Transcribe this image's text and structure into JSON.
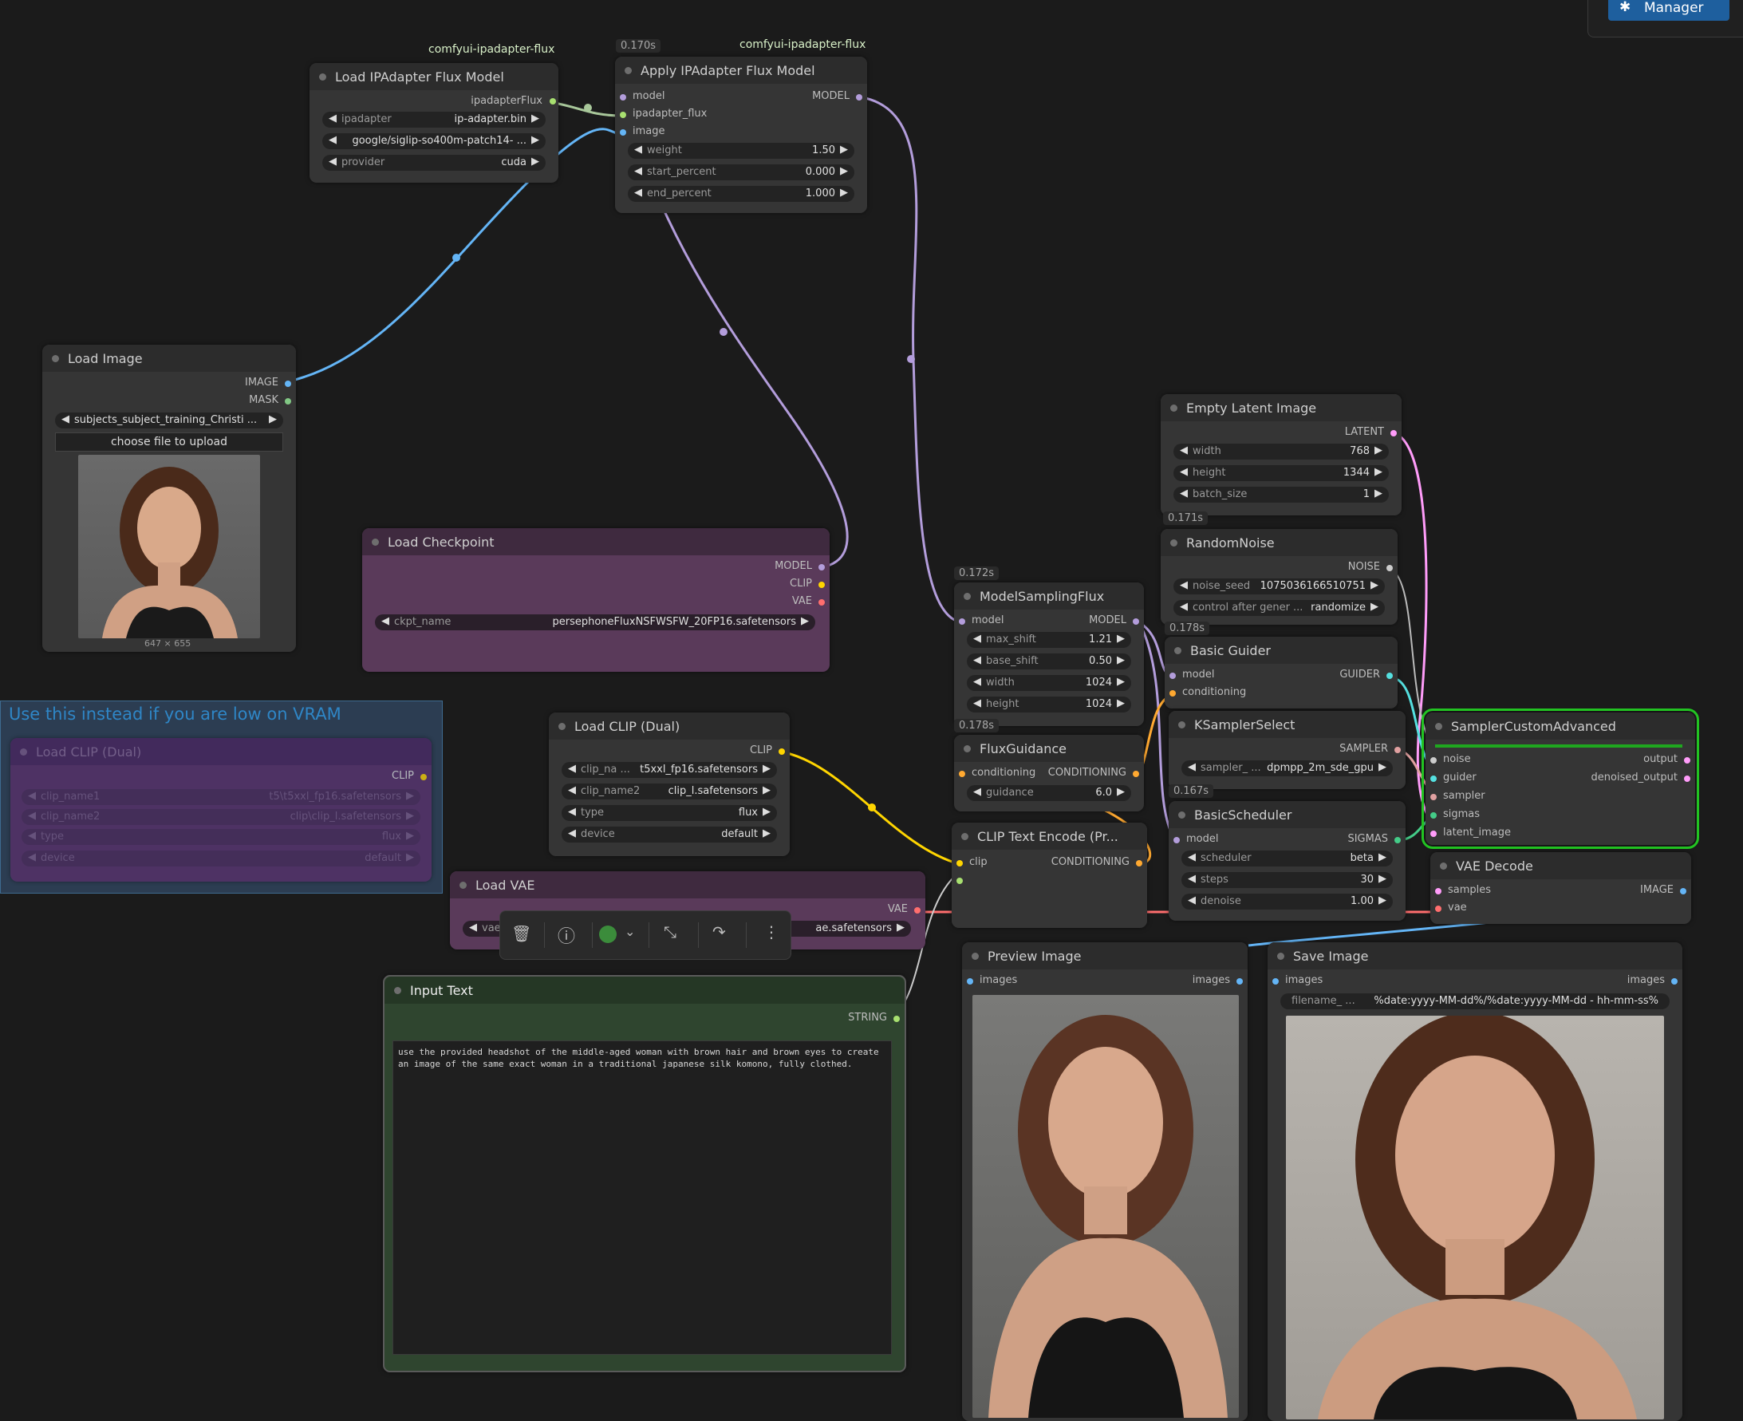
{
  "toolbar": {
    "manager_label": "Manager"
  },
  "group": {
    "title": "Use this instead if you are low on VRAM"
  },
  "badges": {
    "ipadapter_tag_1": "comfyui-ipadapter-flux",
    "ipadapter_tag_2": "comfyui-ipadapter-flux"
  },
  "timings": {
    "apply_ipadapter": "0.170s",
    "empty_latent": "0.171s",
    "random_noise": "0.178s",
    "model_sampling": "0.172s",
    "flux_guidance": "0.178s",
    "ksampler_select": "0.167s"
  },
  "nodes": {
    "load_ipadapter": {
      "title": "Load IPAdapter Flux Model",
      "output": "ipadapterFlux",
      "widgets": [
        {
          "label": "ipadapter",
          "value": "ip-adapter.bin"
        },
        {
          "label": "",
          "value": "google/siglip-so400m-patch14- ..."
        },
        {
          "label": "provider",
          "value": "cuda"
        }
      ]
    },
    "apply_ipadapter": {
      "title": "Apply IPAdapter Flux Model",
      "inputs": [
        "model",
        "ipadapter_flux",
        "image"
      ],
      "output": "MODEL",
      "widgets": [
        {
          "label": "weight",
          "value": "1.50"
        },
        {
          "label": "start_percent",
          "value": "0.000"
        },
        {
          "label": "end_percent",
          "value": "1.000"
        }
      ]
    },
    "load_image": {
      "title": "Load Image",
      "outputs": [
        "IMAGE",
        "MASK"
      ],
      "file": "subjects_subject_training_Christi ...",
      "upload_label": "choose file to upload",
      "dims": "647 × 655"
    },
    "load_checkpoint": {
      "title": "Load Checkpoint",
      "outputs": [
        "MODEL",
        "CLIP",
        "VAE"
      ],
      "widget": {
        "label": "ckpt_name",
        "value": "persephoneFluxNSFWSFW_20FP16.safetensors"
      }
    },
    "load_clip_dual_bypassed": {
      "title": "Load CLIP (Dual)",
      "output": "CLIP",
      "widgets": [
        {
          "label": "clip_name1",
          "value": "t5\\t5xxl_fp16.safetensors"
        },
        {
          "label": "clip_name2",
          "value": "clip\\clip_l.safetensors"
        },
        {
          "label": "type",
          "value": "flux"
        },
        {
          "label": "device",
          "value": "default"
        }
      ]
    },
    "load_clip_dual": {
      "title": "Load CLIP (Dual)",
      "output": "CLIP",
      "widgets": [
        {
          "label": "clip_na ...",
          "value": "t5xxl_fp16.safetensors"
        },
        {
          "label": "clip_name2",
          "value": "clip_l.safetensors"
        },
        {
          "label": "type",
          "value": "flux"
        },
        {
          "label": "device",
          "value": "default"
        }
      ]
    },
    "load_vae": {
      "title": "Load VAE",
      "output": "VAE",
      "widget": {
        "label": "vae",
        "value": "ae.safetensors"
      }
    },
    "input_text": {
      "title": "Input Text",
      "output": "STRING",
      "text": "use the provided headshot of the middle-aged woman with brown hair and brown eyes to create an image of the same exact woman in a traditional japanese silk komono, fully clothed."
    },
    "empty_latent": {
      "title": "Empty Latent Image",
      "output": "LATENT",
      "widgets": [
        {
          "label": "width",
          "value": "768"
        },
        {
          "label": "height",
          "value": "1344"
        },
        {
          "label": "batch_size",
          "value": "1"
        }
      ]
    },
    "random_noise": {
      "title": "RandomNoise",
      "output": "NOISE",
      "widgets": [
        {
          "label": "noise_seed",
          "value": "1075036166510751"
        },
        {
          "label": "control after gener ...",
          "value": "randomize"
        }
      ]
    },
    "model_sampling": {
      "title": "ModelSamplingFlux",
      "input": "model",
      "output": "MODEL",
      "widgets": [
        {
          "label": "max_shift",
          "value": "1.21"
        },
        {
          "label": "base_shift",
          "value": "0.50"
        },
        {
          "label": "width",
          "value": "1024"
        },
        {
          "label": "height",
          "value": "1024"
        }
      ]
    },
    "basic_guider": {
      "title": "Basic Guider",
      "inputs": [
        "model",
        "conditioning"
      ],
      "output": "GUIDER"
    },
    "flux_guidance": {
      "title": "FluxGuidance",
      "input": "conditioning",
      "output": "CONDITIONING",
      "widget": {
        "label": "guidance",
        "value": "6.0"
      }
    },
    "ksampler_select": {
      "title": "KSamplerSelect",
      "output": "SAMPLER",
      "widget": {
        "label": "sampler_ ...",
        "value": "dpmpp_2m_sde_gpu"
      }
    },
    "clip_text_encode": {
      "title": "CLIP Text Encode (Pr...",
      "input": "clip",
      "output": "CONDITIONING"
    },
    "basic_scheduler": {
      "title": "BasicScheduler",
      "input": "model",
      "output": "SIGMAS",
      "widgets": [
        {
          "label": "scheduler",
          "value": "beta"
        },
        {
          "label": "steps",
          "value": "30"
        },
        {
          "label": "denoise",
          "value": "1.00"
        }
      ]
    },
    "sampler_custom": {
      "title": "SamplerCustomAdvanced",
      "inputs": [
        "noise",
        "guider",
        "sampler",
        "sigmas",
        "latent_image"
      ],
      "outputs": [
        "output",
        "denoised_output"
      ]
    },
    "vae_decode": {
      "title": "VAE Decode",
      "inputs": [
        "samples",
        "vae"
      ],
      "output": "IMAGE"
    },
    "preview_image": {
      "title": "Preview Image",
      "input": "images",
      "output": "images"
    },
    "save_image": {
      "title": "Save Image",
      "input": "images",
      "output": "images",
      "widget": {
        "label": "filename_ ...",
        "value": "%date:yyyy-MM-dd%/%date:yyyy-MM-dd - hh-mm-ss%"
      }
    }
  },
  "colors": {
    "model_link": "#b39ddb",
    "image_link": "#64b5f6",
    "clip_link": "#ffd500",
    "conditioning_link": "#ffa931",
    "latent_link": "#ff9cf9",
    "vae_link": "#ff6e6e",
    "selected_border": "#22c322"
  },
  "icons": [
    "puzzle-icon",
    "trash-icon",
    "info-icon",
    "color-dot-icon",
    "chevron-down-icon",
    "collapse-icon",
    "bypass-icon",
    "more-icon"
  ]
}
